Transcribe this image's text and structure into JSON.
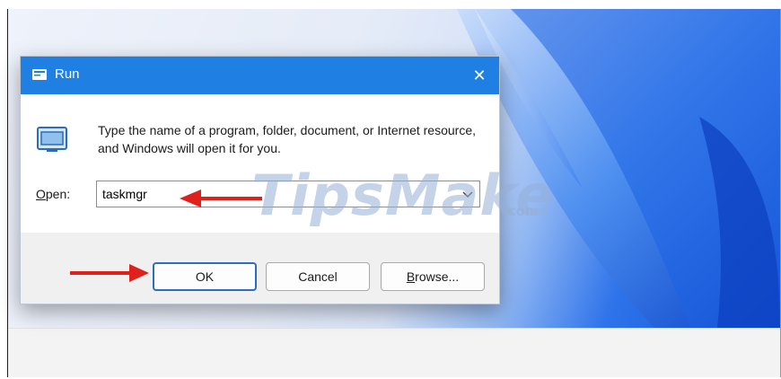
{
  "dialog": {
    "title": "Run",
    "close_glyph": "✕",
    "description": "Type the name of a program, folder, document, or Internet resource, and Windows will open it for you.",
    "open_label_accel": "O",
    "open_label_rest": "pen:",
    "open_value": "taskmgr",
    "buttons": {
      "ok": "OK",
      "cancel": "Cancel",
      "browse_accel": "B",
      "browse_rest": "rowse..."
    }
  },
  "watermark": {
    "text": "TipsMake",
    "suffix": ".com"
  },
  "icons": {
    "title_icon": "run-icon",
    "dialog_icon": "run-window-icon",
    "arrows": [
      "red-arrow-icon",
      "red-arrow-icon"
    ]
  },
  "colors": {
    "titlebar": "#1f7fe3",
    "accent": "#2b6cc4",
    "annotation_arrow": "#e0201a"
  }
}
